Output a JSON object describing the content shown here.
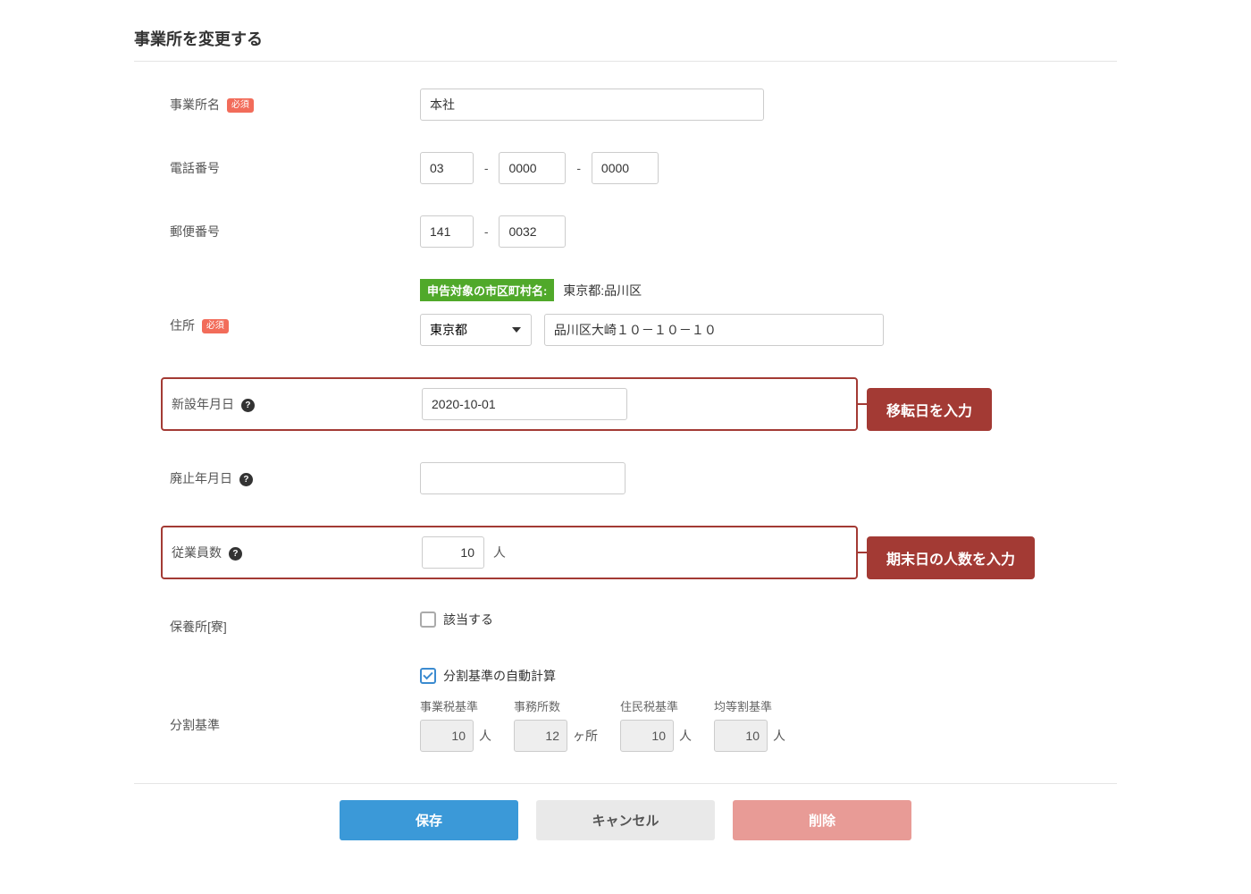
{
  "title": "事業所を変更する",
  "labels": {
    "office_name": "事業所名",
    "required": "必須",
    "phone": "電話番号",
    "postal": "郵便番号",
    "address": "住所",
    "city_badge": "申告対象の市区町村名:",
    "city_value": "東京都:品川区",
    "new_date": "新設年月日",
    "abolish_date": "廃止年月日",
    "employees": "従業員数",
    "dorm": "保養所[寮]",
    "dorm_check": "該当する",
    "split": "分割基準",
    "auto_calc": "分割基準の自動計算",
    "split1": "事業税基準",
    "split2": "事務所数",
    "split3": "住民税基準",
    "split4": "均等割基準"
  },
  "units": {
    "person": "人",
    "place": "ヶ所"
  },
  "values": {
    "office_name": "本社",
    "tel1": "03",
    "tel2": "0000",
    "tel3": "0000",
    "zip1": "141",
    "zip2": "0032",
    "prefecture": "東京都",
    "address_rest": "品川区大崎１０－１０－１０",
    "new_date": "2020-10-01",
    "abolish_date": "",
    "employees": "10",
    "split1_val": "10",
    "split2_val": "12",
    "split3_val": "10",
    "split4_val": "10"
  },
  "callouts": {
    "new_date": "移転日を入力",
    "employees": "期末日の人数を入力"
  },
  "buttons": {
    "save": "保存",
    "cancel": "キャンセル",
    "delete": "削除"
  }
}
